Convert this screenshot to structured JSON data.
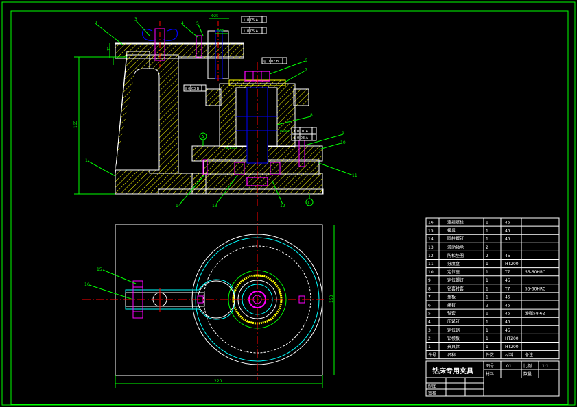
{
  "colors": {
    "background": "#000000",
    "frame": "#00ff00",
    "outline": "#ffffff",
    "centerline": "#ff0000",
    "hatch": "#ffff00",
    "hidden": "#0000ff",
    "dimension": "#00ff00",
    "detail": "#ff00ff",
    "cyan": "#00ffff"
  },
  "balloons_front": [
    "3",
    "2",
    "4",
    "5",
    "6",
    "7",
    "8",
    "9",
    "10",
    "11",
    "1",
    "14",
    "13",
    "12"
  ],
  "balloons_top": [
    "15",
    "16"
  ],
  "dims": {
    "height": "165",
    "width": "220",
    "depth": "150",
    "d1": "Φ25",
    "d2": "Φ35",
    "datum_a": "A",
    "datum_c": "C"
  },
  "tolerance_frames": [
    "⊥ 0.05 A",
    "⊥ 0.05 A",
    "◎ 0.02 B",
    "∥ 0.03 B",
    "⊥ 0.01 A",
    "⊥ 0.03 A"
  ],
  "bom_rows": [
    {
      "no": "16",
      "name": "连接螺栓",
      "qty": "1",
      "mat": "45",
      "note": ""
    },
    {
      "no": "15",
      "name": "螺母",
      "qty": "1",
      "mat": "45",
      "note": ""
    },
    {
      "no": "14",
      "name": "圆柱螺钉",
      "qty": "1",
      "mat": "45",
      "note": ""
    },
    {
      "no": "13",
      "name": "滚动轴承",
      "qty": "2",
      "mat": "",
      "note": ""
    },
    {
      "no": "12",
      "name": "防松垫圈",
      "qty": "2",
      "mat": "45",
      "note": ""
    },
    {
      "no": "11",
      "name": "分度盘",
      "qty": "1",
      "mat": "HT200",
      "note": ""
    },
    {
      "no": "10",
      "name": "定位座",
      "qty": "1",
      "mat": "T7",
      "note": "55-60HRC"
    },
    {
      "no": "9",
      "name": "定位螺钉",
      "qty": "1",
      "mat": "45",
      "note": ""
    },
    {
      "no": "8",
      "name": "钻套衬套",
      "qty": "1",
      "mat": "T7",
      "note": "55-60HRC"
    },
    {
      "no": "7",
      "name": "垫板",
      "qty": "1",
      "mat": "45",
      "note": ""
    },
    {
      "no": "6",
      "name": "螺钉",
      "qty": "2",
      "mat": "45",
      "note": ""
    },
    {
      "no": "5",
      "name": "轴套",
      "qty": "1",
      "mat": "45",
      "note": "渗碳58-62"
    },
    {
      "no": "4",
      "name": "压紧钉",
      "qty": "1",
      "mat": "45",
      "note": ""
    },
    {
      "no": "3",
      "name": "定位销",
      "qty": "1",
      "mat": "45",
      "note": ""
    },
    {
      "no": "2",
      "name": "钻模板",
      "qty": "1",
      "mat": "HT200",
      "note": ""
    },
    {
      "no": "1",
      "name": "夹具体",
      "qty": "1",
      "mat": "HT200",
      "note": ""
    }
  ],
  "bom_header": {
    "no": "件号",
    "name": "名称",
    "qty": "件数",
    "mat": "材料",
    "note": "备注"
  },
  "title_block": {
    "title": "钻床专用夹具",
    "drawing_no_label": "图号",
    "drawing_no": "01",
    "scale_label": "比例",
    "scale": "1:1",
    "material_label": "材料",
    "qty_label": "数量",
    "drawn_label": "制图",
    "checked_label": "审核"
  }
}
